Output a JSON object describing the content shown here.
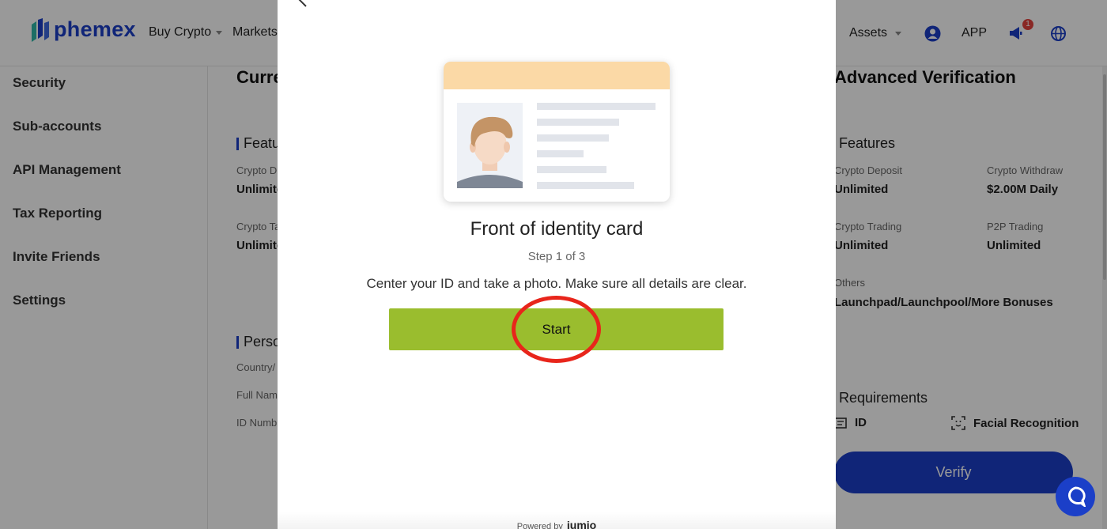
{
  "header": {
    "logo_text": "phemex",
    "nav": [
      {
        "label": "Buy Crypto"
      },
      {
        "label": "Markets"
      }
    ],
    "assets_label": "Assets",
    "app_label": "APP",
    "notification_count": "1"
  },
  "sidebar": {
    "items": [
      {
        "label": "Security"
      },
      {
        "label": "Sub-accounts"
      },
      {
        "label": "API Management"
      },
      {
        "label": "Tax Reporting"
      },
      {
        "label": "Invite Friends"
      },
      {
        "label": "Settings"
      }
    ]
  },
  "main": {
    "current_title": "Curre",
    "advanced_title": "Advanced Verification",
    "left_features_title": "Featu",
    "left_features": [
      {
        "label": "Crypto D",
        "value": "Unlimite"
      },
      {
        "label": "Crypto Ta",
        "value": "Unlimite"
      }
    ],
    "personal_title": "Perso",
    "personal_fields": [
      "Country/",
      "Full Nam",
      "ID Numb"
    ],
    "right_features_title": "Features",
    "right_features": [
      {
        "label": "Crypto Deposit",
        "value": "Unlimited"
      },
      {
        "label": "Crypto Withdraw",
        "value": "$2.00M Daily"
      },
      {
        "label": "Crypto Trading",
        "value": "Unlimited"
      },
      {
        "label": "P2P Trading",
        "value": "Unlimited"
      },
      {
        "label": "Others",
        "value": "Launchpad/Launchpool/More Bonuses"
      }
    ],
    "requirements_title": "Requirements",
    "requirements": [
      {
        "label": "ID"
      },
      {
        "label": "Facial Recognition"
      }
    ],
    "verify_label": "Verify"
  },
  "modal": {
    "title": "Front of identity card",
    "step": "Step 1 of 3",
    "description": "Center your ID and take a photo. Make sure all details are clear.",
    "start_label": "Start",
    "powered_by": "Powered by",
    "powered_brand": "jumio"
  },
  "colors": {
    "brand_blue": "#1b3fc8",
    "start_green": "#9abd2e",
    "highlight_red": "#e8251b",
    "card_header": "#fbd9a6"
  }
}
